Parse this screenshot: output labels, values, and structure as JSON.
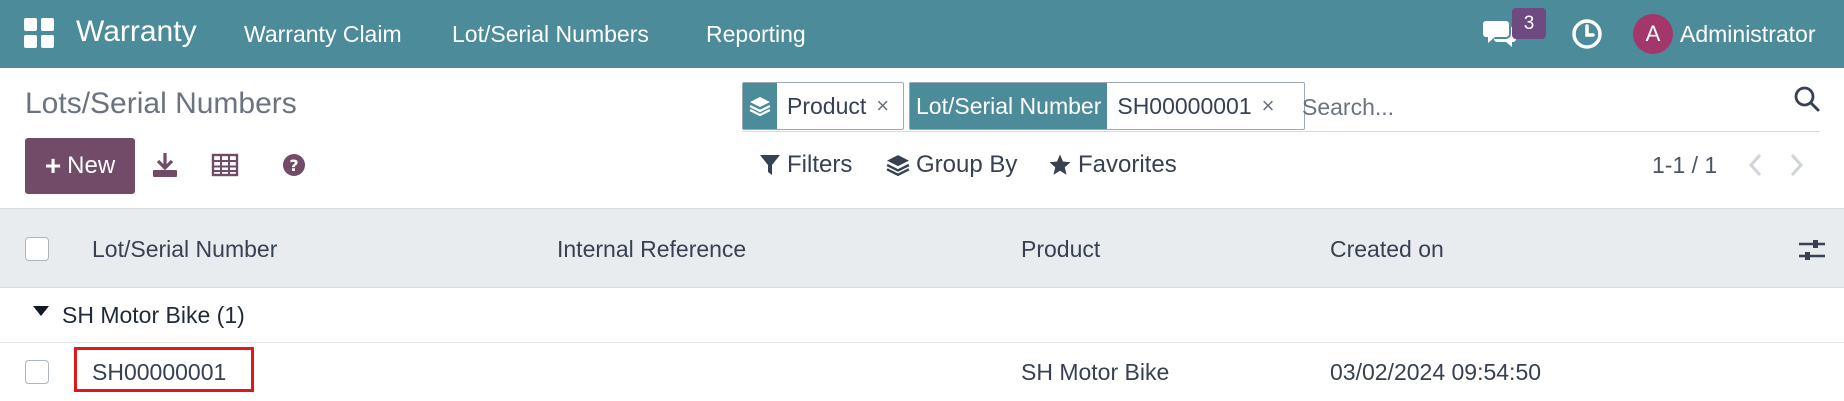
{
  "navbar": {
    "app_title": "Warranty",
    "menu": [
      "Warranty Claim",
      "Lot/Serial Numbers",
      "Reporting"
    ],
    "chat_badge": "3",
    "avatar_initial": "A",
    "user_name": "Administrator",
    "color": "#4c8b99"
  },
  "page": {
    "title": "Lots/Serial Numbers"
  },
  "search": {
    "facets": [
      {
        "icon": "layers-icon",
        "value": "Product"
      },
      {
        "label": "Lot/Serial Number",
        "value": "SH00000001"
      }
    ],
    "placeholder": "Search..."
  },
  "toolbar": {
    "new_label": "New",
    "filters_label": "Filters",
    "group_by_label": "Group By",
    "favorites_label": "Favorites",
    "pager": "1-1 / 1",
    "new_color": "#714b67"
  },
  "list": {
    "columns": [
      "Lot/Serial Number",
      "Internal Reference",
      "Product",
      "Created on"
    ],
    "group": {
      "label": "SH Motor Bike (1)"
    },
    "rows": [
      {
        "lot": "SH00000001",
        "internal_reference": "",
        "product": "SH Motor Bike",
        "created_on": "03/02/2024 09:54:50"
      }
    ],
    "highlight_color": "#e0161c"
  }
}
